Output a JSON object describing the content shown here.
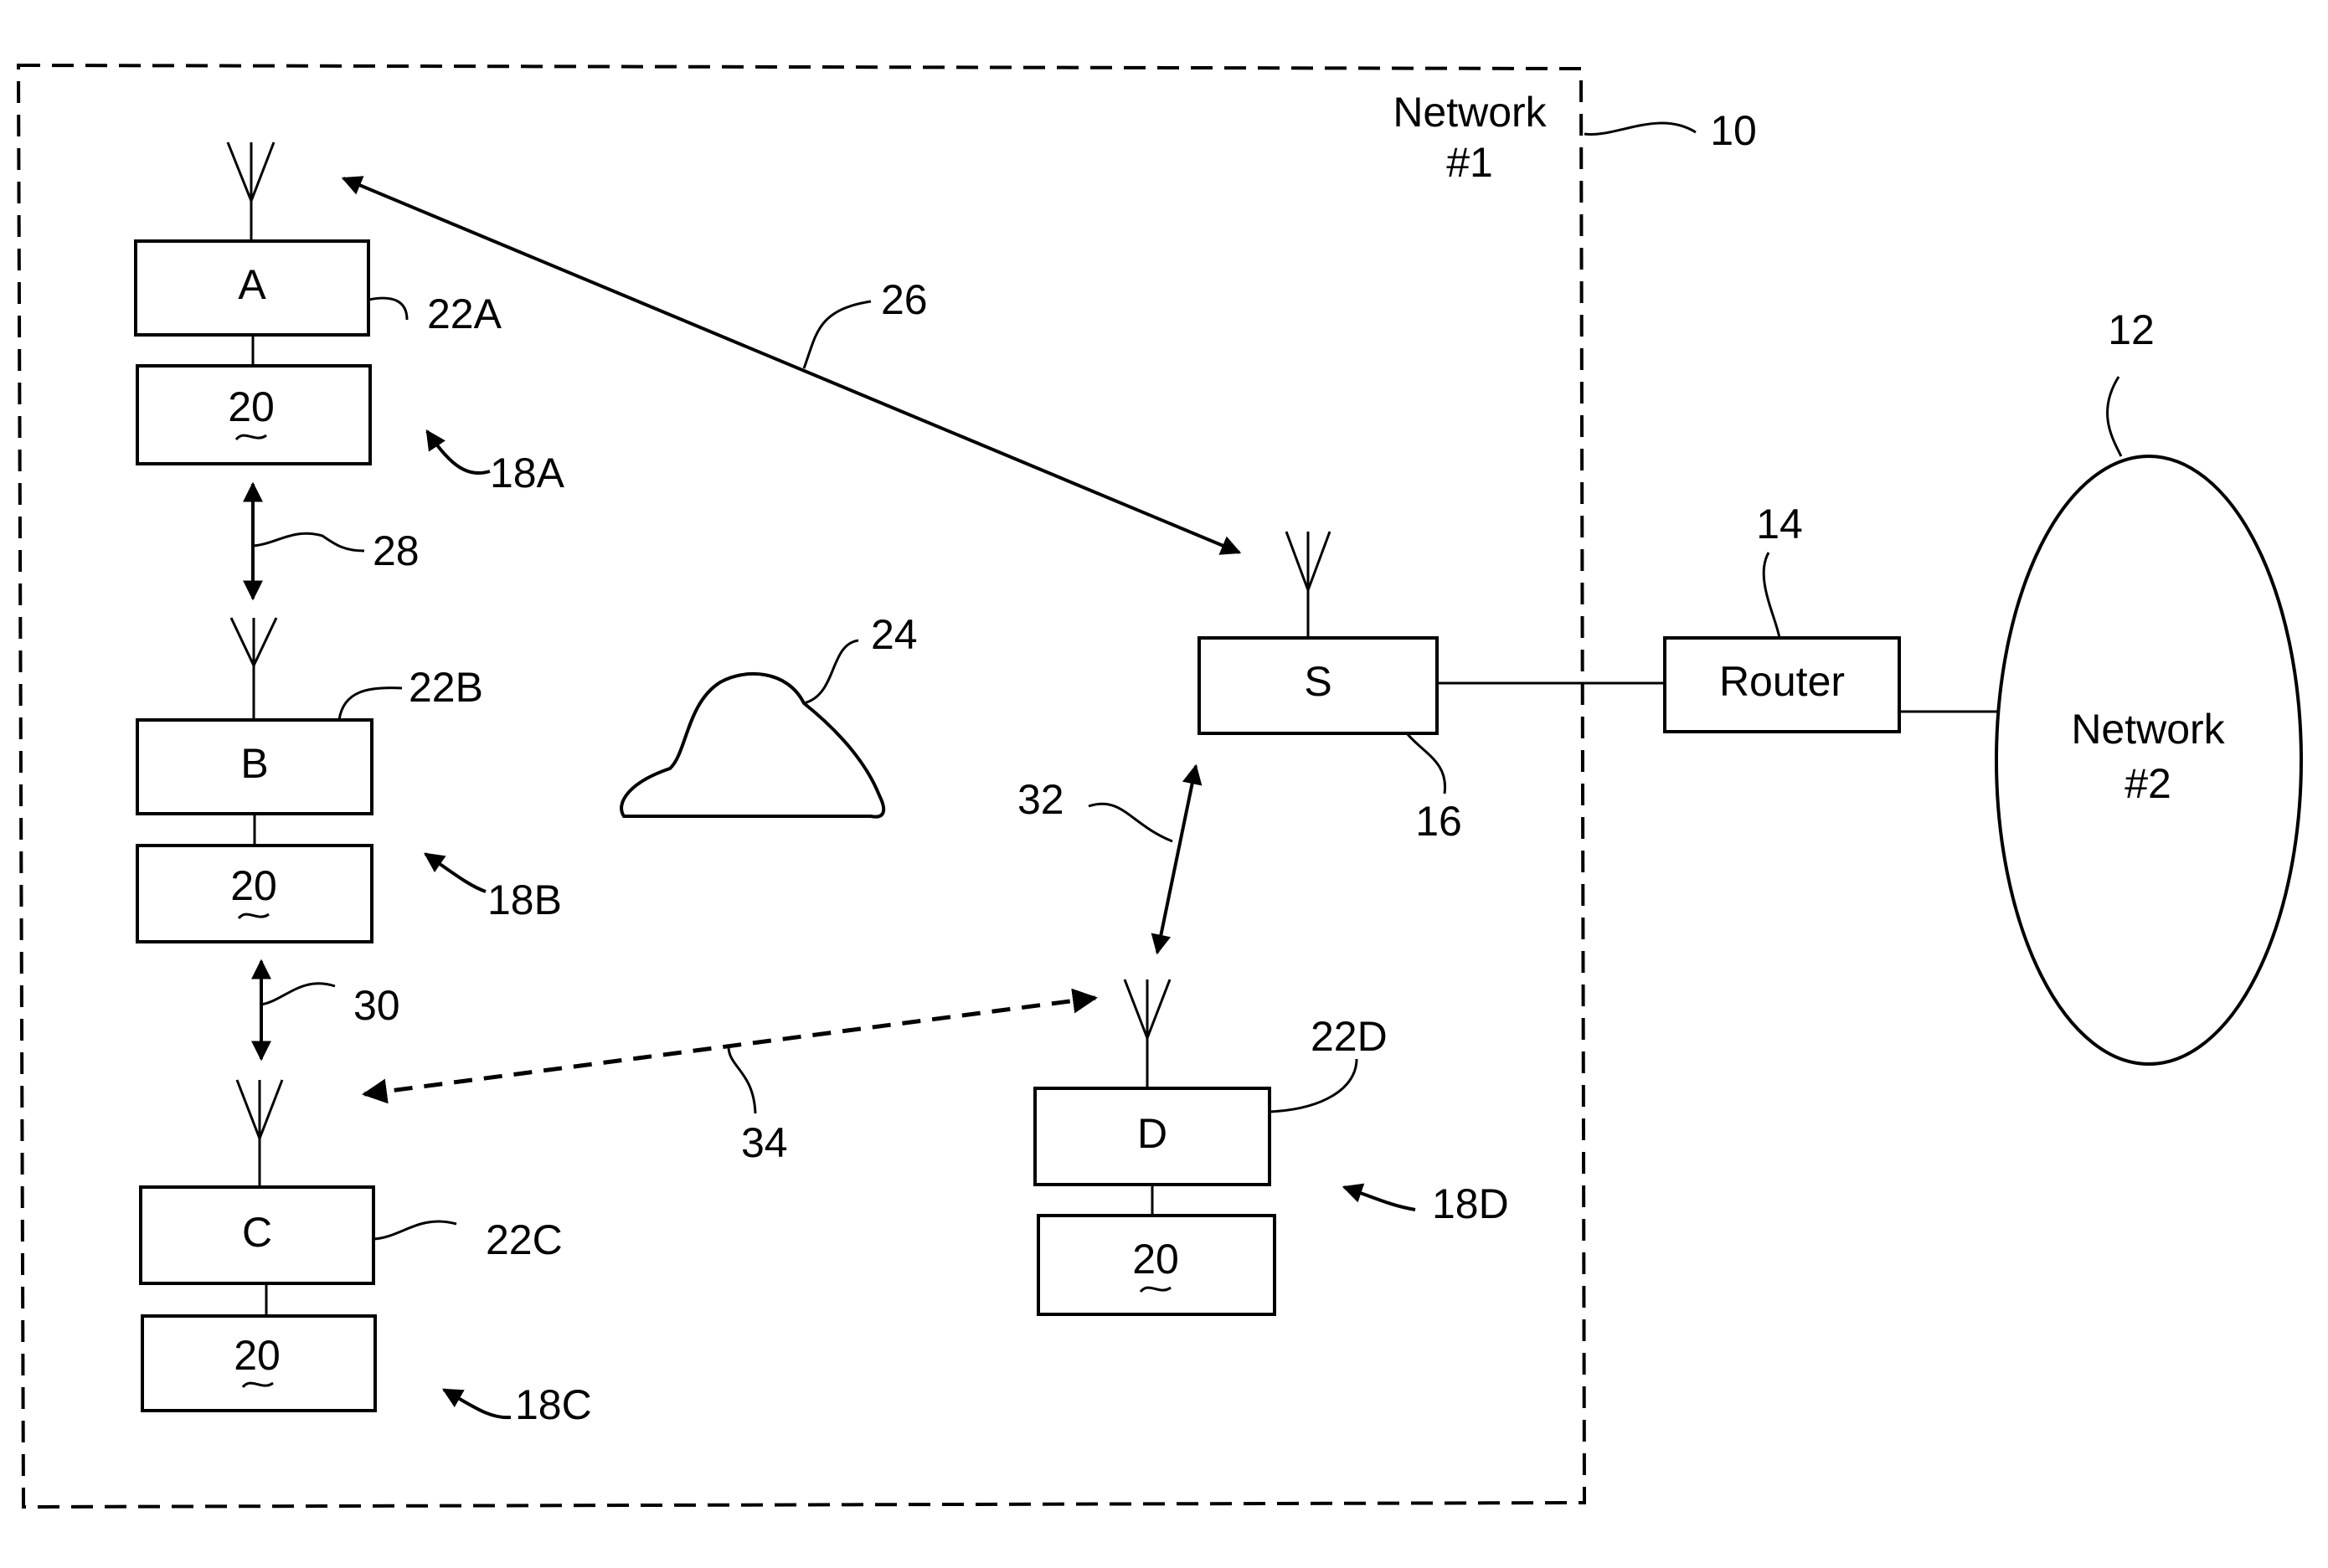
{
  "diagram": {
    "network1": {
      "title_line1": "Network",
      "title_line2": "#1",
      "ref": "10"
    },
    "network2": {
      "title_line1": "Network",
      "title_line2": "#2",
      "ref": "12"
    },
    "router": {
      "label": "Router",
      "ref": "14"
    },
    "server": {
      "label": "S",
      "ref": "16"
    },
    "nodes": [
      {
        "id": "A",
        "label": "A",
        "radio_ref": "22A",
        "device_ref": "18A",
        "sub_label": "20"
      },
      {
        "id": "B",
        "label": "B",
        "radio_ref": "22B",
        "device_ref": "18B",
        "sub_label": "20"
      },
      {
        "id": "C",
        "label": "C",
        "radio_ref": "22C",
        "device_ref": "18C",
        "sub_label": "20"
      },
      {
        "id": "D",
        "label": "D",
        "radio_ref": "22D",
        "device_ref": "18D",
        "sub_label": "20"
      }
    ],
    "obstacle": {
      "ref": "24"
    },
    "links": [
      {
        "from": "A",
        "to": "S",
        "ref": "26",
        "style": "solid"
      },
      {
        "from": "A",
        "to": "B",
        "ref": "28",
        "style": "solid"
      },
      {
        "from": "B",
        "to": "C",
        "ref": "30",
        "style": "solid"
      },
      {
        "from": "S",
        "to": "D",
        "ref": "32",
        "style": "solid"
      },
      {
        "from": "C",
        "to": "D",
        "ref": "34",
        "style": "dashed"
      }
    ]
  }
}
